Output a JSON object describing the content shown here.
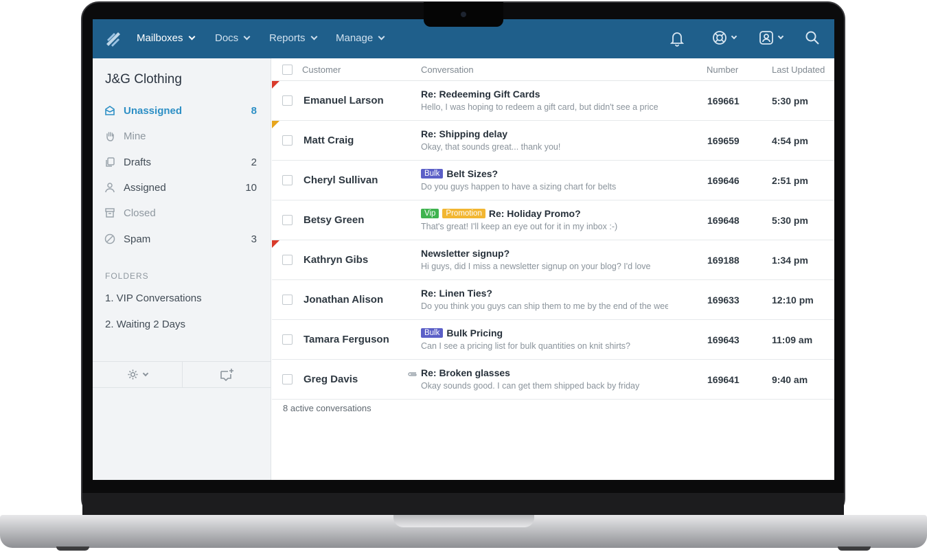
{
  "nav": {
    "items": [
      {
        "label": "Mailboxes",
        "active": true
      },
      {
        "label": "Docs",
        "active": false
      },
      {
        "label": "Reports",
        "active": false
      },
      {
        "label": "Manage",
        "active": false
      }
    ],
    "icons": [
      "bell-icon",
      "lifebuoy-icon",
      "profile-icon",
      "search-icon"
    ]
  },
  "sidebar": {
    "mailbox_name": "J&G Clothing",
    "items": [
      {
        "label": "Unassigned",
        "count": "8",
        "icon": "inbox-icon"
      },
      {
        "label": "Mine",
        "count": "",
        "icon": "hand-icon"
      },
      {
        "label": "Drafts",
        "count": "2",
        "icon": "drafts-icon"
      },
      {
        "label": "Assigned",
        "count": "10",
        "icon": "person-icon"
      },
      {
        "label": "Closed",
        "count": "",
        "icon": "archive-icon"
      },
      {
        "label": "Spam",
        "count": "3",
        "icon": "block-icon"
      }
    ],
    "folders_label": "FOLDERS",
    "folders": [
      "1. VIP Conversations",
      "2. Waiting 2 Days"
    ]
  },
  "list": {
    "columns": {
      "customer": "Customer",
      "conversation": "Conversation",
      "number": "Number",
      "updated": "Last Updated"
    },
    "rows": [
      {
        "customer": "Emanuel Larson",
        "subject": "Re: Redeeming Gift Cards",
        "preview": "Hello, I was hoping to redeem a gift card, but didn't see a price",
        "number": "169661",
        "time": "5:30 pm",
        "flag": "red"
      },
      {
        "customer": "Matt Craig",
        "subject": "Re: Shipping delay",
        "preview": "Okay, that sounds great... thank you!",
        "number": "169659",
        "time": "4:54 pm",
        "flag": "yellow"
      },
      {
        "customer": "Cheryl Sullivan",
        "subject": "Belt Sizes?",
        "preview": "Do you guys happen to have a sizing chart for belts",
        "number": "169646",
        "time": "2:51 pm",
        "tags": [
          "Bulk"
        ]
      },
      {
        "customer": "Betsy Green",
        "subject": "Re: Holiday Promo?",
        "preview": "That's great! I'll keep an eye out for it in my inbox :-)",
        "number": "169648",
        "time": "5:30 pm",
        "tags": [
          "Vip",
          "Promotion"
        ]
      },
      {
        "customer": "Kathryn Gibs",
        "subject": "Newsletter signup?",
        "preview": "Hi guys, did I miss a newsletter signup on your blog? I'd love",
        "number": "169188",
        "time": "1:34 pm",
        "flag": "red"
      },
      {
        "customer": "Jonathan Alison",
        "subject": "Re: Linen Ties?",
        "preview": "Do you think you guys can ship them to me by the end of the week",
        "number": "169633",
        "time": "12:10 pm"
      },
      {
        "customer": "Tamara Ferguson",
        "subject": "Bulk Pricing",
        "preview": "Can I see a pricing list for bulk quantities on knit shirts?",
        "number": "169643",
        "time": "11:09 am",
        "tags": [
          "Bulk"
        ]
      },
      {
        "customer": "Greg Davis",
        "subject": "Re: Broken glasses",
        "preview": "Okay sounds good. I can get them shipped back by friday",
        "number": "169641",
        "time": "9:40 am",
        "attachment": true
      }
    ],
    "footer": "8 active conversations"
  },
  "colors": {
    "topbar": "#1f5f8b",
    "accent": "#2d8fc5",
    "tag_bulk": "#5b5fc7",
    "tag_vip": "#3fb34f",
    "tag_promotion": "#f2b632",
    "flag_red": "#d93a2b",
    "flag_yellow": "#e7a51c"
  }
}
